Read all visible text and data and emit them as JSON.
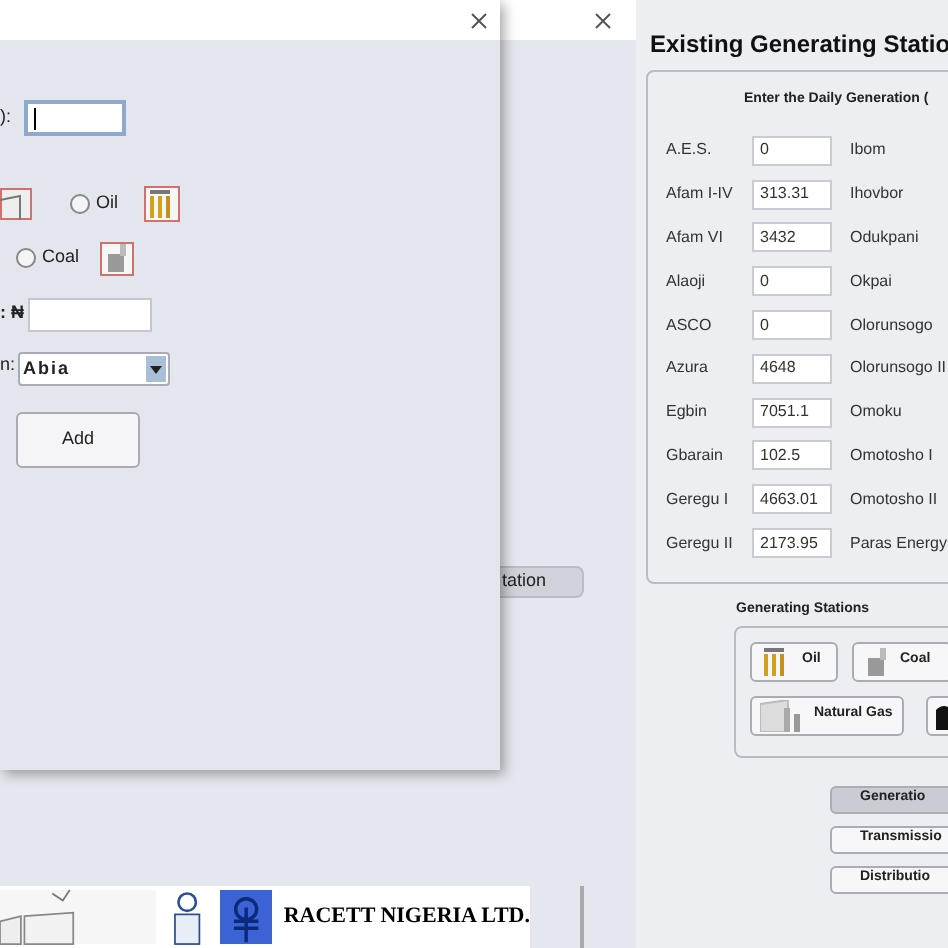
{
  "back_window": {
    "button": "tation"
  },
  "dialog": {
    "id_label": "):",
    "fuel_options": [
      {
        "label": "Oil",
        "selected": false
      },
      {
        "label": "Coal",
        "selected": false
      }
    ],
    "amount_label": ": ₦",
    "region_label": "n:",
    "region_value": "Abia",
    "add_button": "Add"
  },
  "footer": {
    "company": "RACETT NIGERIA LTD."
  },
  "stations_window": {
    "title": "Existing Generating Statio",
    "subtitle": "Enter the Daily Generation (",
    "rows": [
      {
        "name": "A.E.S.",
        "value": "0",
        "other": "Ibom"
      },
      {
        "name": "Afam I-IV",
        "value": "313.31",
        "other": "Ihovbor"
      },
      {
        "name": "Afam VI",
        "value": "3432",
        "other": "Odukpani"
      },
      {
        "name": "Alaoji",
        "value": "0",
        "other": "Okpai"
      },
      {
        "name": "ASCO",
        "value": "0",
        "other": "Olorunsogo"
      },
      {
        "name": "Azura",
        "value": "4648",
        "other": "Olorunsogo II"
      },
      {
        "name": "Egbin",
        "value": "7051.1",
        "other": "Omoku"
      },
      {
        "name": "Gbarain",
        "value": "102.5",
        "other": "Omotosho I"
      },
      {
        "name": "Geregu I",
        "value": "4663.01",
        "other": "Omotosho II"
      },
      {
        "name": "Geregu II",
        "value": "2173.95",
        "other": "Paras Energy"
      }
    ],
    "group_title": "Generating Stations",
    "fuel_buttons": [
      {
        "kind": "oil",
        "label": "Oil"
      },
      {
        "kind": "coal",
        "label": "Coal"
      },
      {
        "kind": "gas",
        "label": "Natural Gas"
      }
    ],
    "nav": [
      {
        "label": "Generatio",
        "selected": true
      },
      {
        "label": "Transmissio",
        "selected": false
      },
      {
        "label": "Distributio",
        "selected": false
      }
    ]
  }
}
